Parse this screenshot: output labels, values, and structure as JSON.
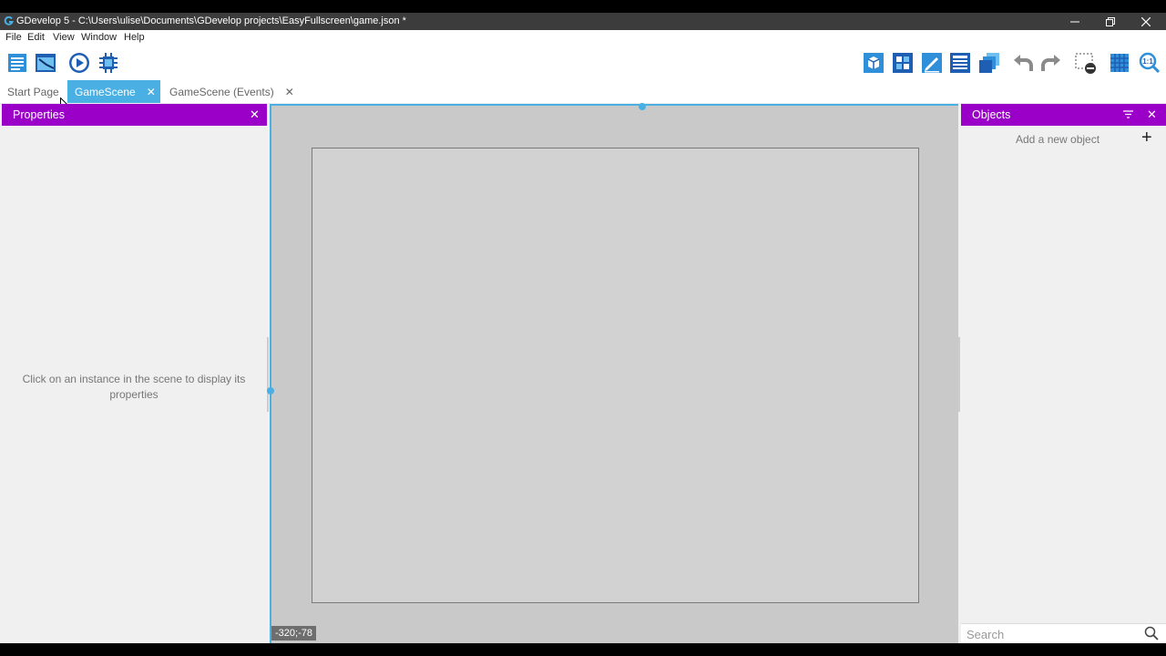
{
  "window": {
    "title": "GDevelop 5 - C:\\Users\\ulise\\Documents\\GDevelop projects\\EasyFullscreen\\game.json *",
    "buttons": [
      "minimize-icon",
      "restore-icon",
      "close-icon"
    ]
  },
  "menu": {
    "items": [
      "File",
      "Edit",
      "View",
      "Window",
      "Help"
    ]
  },
  "toolbar": {
    "left": [
      "project-manager-icon",
      "scene-window-icon",
      "preview-play-icon",
      "debugger-icon"
    ],
    "right": [
      "scene-properties-icon",
      "open-objects-icon",
      "object-groups-icon",
      "layers-icon",
      "instances-list-icon",
      "undo-icon",
      "redo-icon",
      "delete-icon",
      "grid-icon",
      "zoom-icon"
    ]
  },
  "tabs": [
    {
      "label": "Start Page",
      "active": false,
      "closable": false
    },
    {
      "label": "GameScene",
      "active": true,
      "closable": true
    },
    {
      "label": "GameScene (Events)",
      "active": false,
      "closable": true
    }
  ],
  "properties": {
    "title": "Properties",
    "hint": "Click on an instance in the scene to display its properties"
  },
  "scene": {
    "coords": "-320;-78"
  },
  "objects": {
    "title": "Objects",
    "add_label": "Add a new object",
    "search_placeholder": "Search"
  },
  "colors": {
    "accent_purple": "#9b00c9",
    "active_tab": "#4ab0e4",
    "toolbar_blue": "#1e5fb4"
  }
}
